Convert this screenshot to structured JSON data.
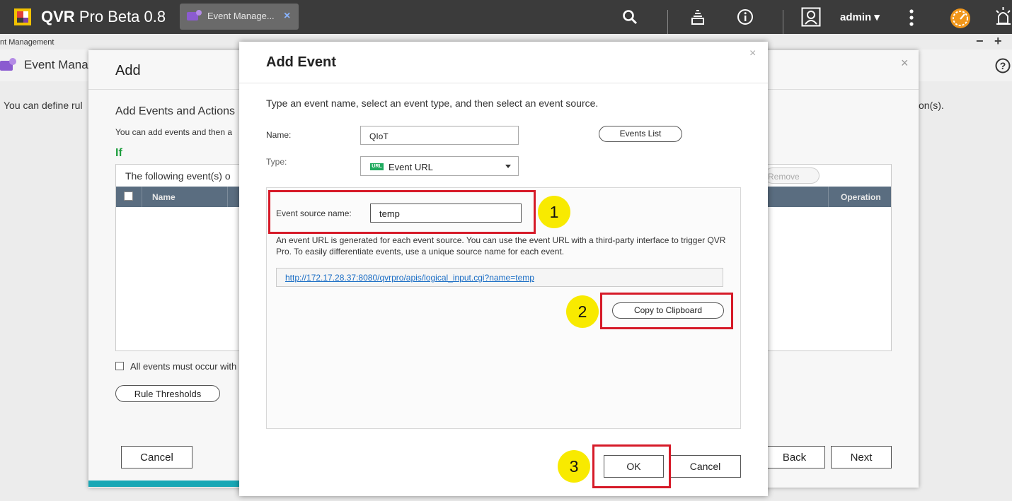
{
  "topbar": {
    "app_name": "QVR",
    "app_suffix": "Pro Beta 0.8",
    "tab_label": "Event Manage...",
    "tab_close": "×",
    "user": "admin ▾"
  },
  "background": {
    "window_title": "nt Management",
    "min_ctrl": "−",
    "max_ctrl": "+",
    "header_title": "Event Mana",
    "desc_left": "You can define rul",
    "desc_right": "on(s)."
  },
  "add_dialog": {
    "title": "Add",
    "close": "×",
    "subtitle": "Add Events and Actions",
    "subtitle_desc": "You can add events and then a",
    "if_label": "If",
    "table_caption": "The following event(s) o",
    "remove_label": "Remove",
    "col_name": "Name",
    "col_operation": "Operation",
    "all_events_label": "All events must occur with",
    "rule_thresholds": "Rule Thresholds",
    "cancel": "Cancel",
    "back": "Back",
    "next": "Next"
  },
  "add_event": {
    "title": "Add Event",
    "close": "×",
    "instruction": "Type an event name, select an event type, and then select an event source.",
    "name_label": "Name:",
    "name_value": "QIoT",
    "events_list": "Events List",
    "type_label": "Type:",
    "type_badge": "URL",
    "type_value": "Event URL",
    "source_label": "Event source name:",
    "source_value": "temp",
    "source_desc": "An event URL is generated for each event source. You can use the event URL with a third-party interface to trigger QVR Pro. To easily differentiate events, use a unique source name for each event.",
    "event_url": "http://172.17.28.37:8080/qvrpro/apis/logical_input.cgi?name=temp",
    "copy_label": "Copy to Clipboard",
    "ok": "OK",
    "cancel": "Cancel"
  },
  "callouts": {
    "step1": "1",
    "step2": "2",
    "step3": "3"
  },
  "colors": {
    "highlight_red": "#d61a28",
    "marker_yellow": "#f8ea00",
    "link_blue": "#1a6dc5",
    "if_green": "#1e9e3e",
    "progress_teal": "#19a7b5"
  }
}
